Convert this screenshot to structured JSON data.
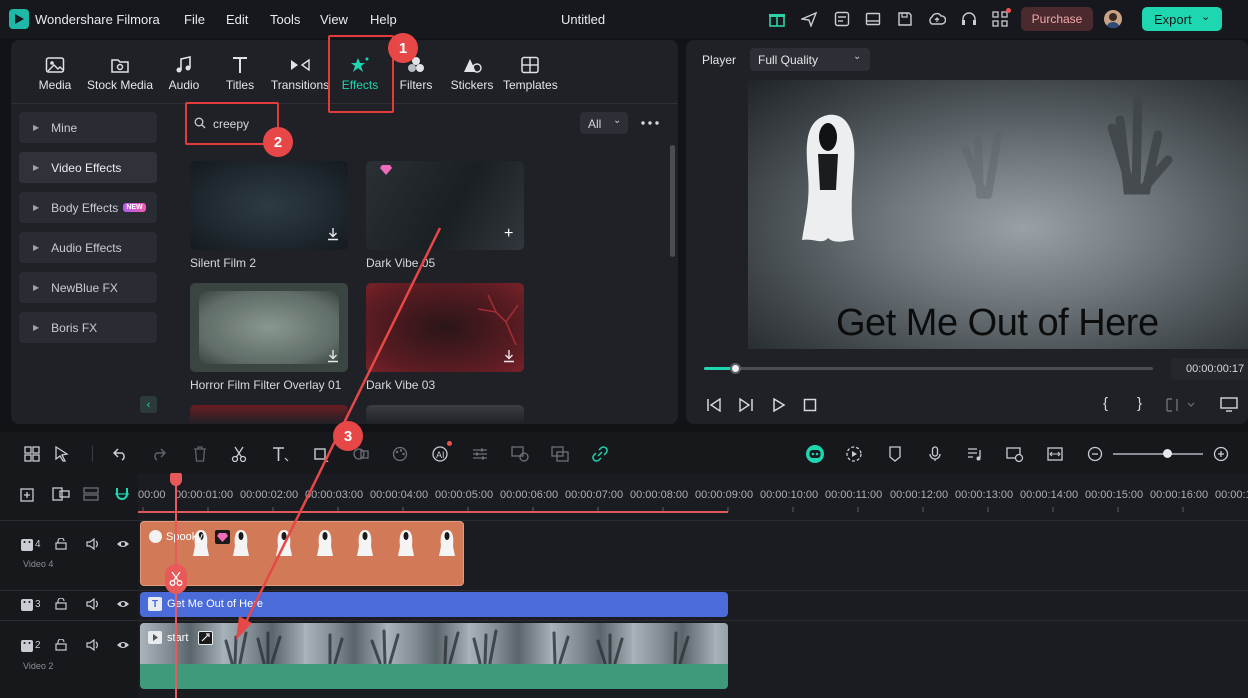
{
  "app": {
    "name": "Wondershare Filmora",
    "doc_title": "Untitled"
  },
  "menu": [
    "File",
    "Edit",
    "Tools",
    "View",
    "Help"
  ],
  "topbar": {
    "purchase": "Purchase",
    "export": "Export"
  },
  "tabs": [
    "Media",
    "Stock Media",
    "Audio",
    "Titles",
    "Transitions",
    "Effects",
    "Filters",
    "Stickers",
    "Templates"
  ],
  "sidebar": [
    {
      "label": "Mine"
    },
    {
      "label": "Video Effects"
    },
    {
      "label": "Body Effects",
      "badge": "NEW"
    },
    {
      "label": "Audio Effects"
    },
    {
      "label": "NewBlue FX"
    },
    {
      "label": "Boris FX"
    }
  ],
  "search": {
    "value": "creepy"
  },
  "filter": {
    "value": "All"
  },
  "effects": [
    {
      "label": "Silent Film 2"
    },
    {
      "label": "Dark Vibe 05"
    },
    {
      "label": "Horror Film Filter Overlay 01"
    },
    {
      "label": "Dark Vibe 03"
    }
  ],
  "player": {
    "label": "Player",
    "quality": "Full Quality",
    "overlay_text": "Get Me Out of Here",
    "timecode": "00:00:00:17",
    "progress": 0.07
  },
  "timeline": {
    "ruler": [
      "00:00",
      "00:00:01:00",
      "00:00:02:00",
      "00:00:03:00",
      "00:00:04:00",
      "00:00:05:00",
      "00:00:06:00",
      "00:00:07:00",
      "00:00:08:00",
      "00:00:09:00",
      "00:00:10:00",
      "00:00:11:00",
      "00:00:12:00",
      "00:00:13:00",
      "00:00:14:00",
      "00:00:15:00",
      "00:00:16:00",
      "00:00:1"
    ],
    "tracks": [
      {
        "index": "4",
        "label": "Video 4",
        "clip": "Spooky"
      },
      {
        "index": "3",
        "label": "",
        "clip": "Get Me Out of Here"
      },
      {
        "index": "2",
        "label": "Video 2",
        "clip": "start"
      }
    ]
  },
  "annotations": [
    "1",
    "2",
    "3"
  ],
  "colors": {
    "accent": "#1ed6b0",
    "highlight": "#e23b3b",
    "purchase": "#f0a8a8",
    "title_clip": "#4a6bd8",
    "sticker_clip": "#d27a57",
    "video_clip": "#3e9a7a"
  }
}
